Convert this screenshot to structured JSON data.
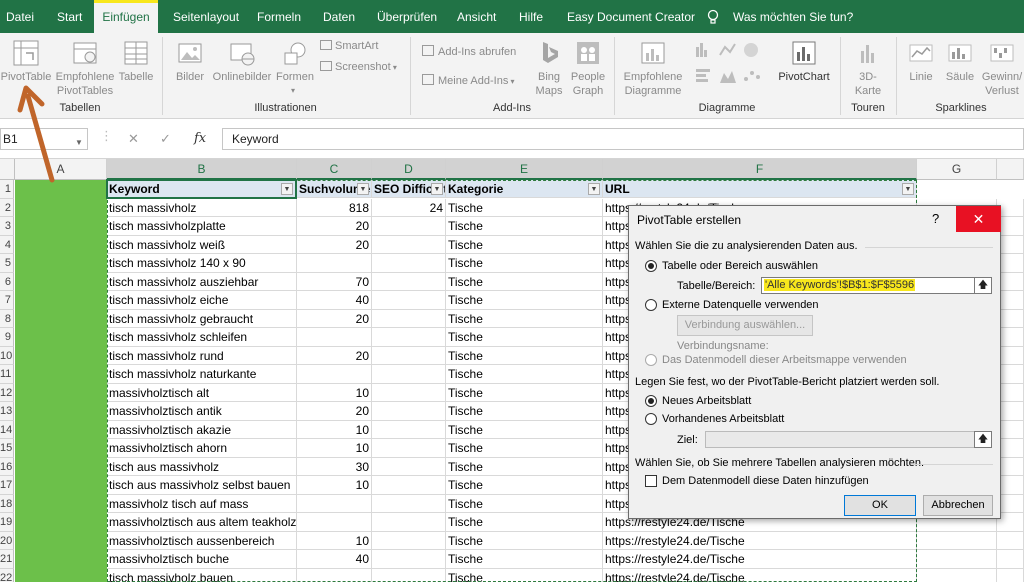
{
  "menu": {
    "items": [
      "Datei",
      "Start",
      "Einfügen",
      "Seitenlayout",
      "Formeln",
      "Daten",
      "Überprüfen",
      "Ansicht",
      "Hilfe",
      "Easy Document Creator"
    ],
    "tell_me": "Was möchten Sie tun?",
    "active": "Einfügen"
  },
  "ribbon": {
    "pivot_table": "PivotTable",
    "rec_pivot_1": "Empfohlene",
    "rec_pivot_2": "PivotTables",
    "table": "Tabelle",
    "group_tables": "Tabellen",
    "pictures": "Bilder",
    "online_pictures": "Onlinebilder",
    "shapes": "Formen",
    "smartart": "SmartArt",
    "screenshot": "Screenshot",
    "group_illustrations": "Illustrationen",
    "get_addins": "Add-Ins abrufen",
    "my_addins": "Meine Add-Ins",
    "bing_maps_1": "Bing",
    "bing_maps_2": "Maps",
    "people_graph_1": "People",
    "people_graph_2": "Graph",
    "group_addins": "Add-Ins",
    "rec_charts_1": "Empfohlene",
    "rec_charts_2": "Diagramme",
    "pivot_chart": "PivotChart",
    "group_charts": "Diagramme",
    "map3d_1": "3D-",
    "map3d_2": "Karte",
    "group_tours": "Touren",
    "spark_line": "Linie",
    "spark_column": "Säule",
    "spark_winloss_1": "Gewinn/",
    "spark_winloss_2": "Verlust",
    "group_sparklines": "Sparklines"
  },
  "formula_bar": {
    "name_box": "B1",
    "cancel": "✕",
    "confirm": "✓",
    "fx": "fx",
    "content": "Keyword"
  },
  "sheet": {
    "columns": [
      "A",
      "B",
      "C",
      "D",
      "E",
      "F",
      "G"
    ],
    "headers": [
      "Keyword",
      "Suchvolumen",
      "SEO Difficulty",
      "Kategorie",
      "URL"
    ],
    "rows": [
      {
        "n": "1"
      },
      {
        "n": "2",
        "kw": "tisch massivholz",
        "sv": "818",
        "seo": "24",
        "kat": "Tische",
        "url": "https://restyle24.de/Tische"
      },
      {
        "n": "3",
        "kw": "tisch massivholzplatte",
        "sv": "20",
        "seo": "",
        "kat": "Tische",
        "url": "https://restyle24.de/Tische"
      },
      {
        "n": "4",
        "kw": "tisch massivholz weiß",
        "sv": "20",
        "seo": "",
        "kat": "Tische",
        "url": "https://restyle24.de/Tische"
      },
      {
        "n": "5",
        "kw": "tisch massivholz 140 x 90",
        "sv": "",
        "seo": "",
        "kat": "Tische",
        "url": "https://restyle24.de/Tische"
      },
      {
        "n": "6",
        "kw": "tisch massivholz ausziehbar",
        "sv": "70",
        "seo": "",
        "kat": "Tische",
        "url": "https://restyle24.de/Tische"
      },
      {
        "n": "7",
        "kw": "tisch massivholz eiche",
        "sv": "40",
        "seo": "",
        "kat": "Tische",
        "url": "https://restyle24.de/Tische"
      },
      {
        "n": "8",
        "kw": "tisch massivholz gebraucht",
        "sv": "20",
        "seo": "",
        "kat": "Tische",
        "url": "https://restyle24.de/Tische"
      },
      {
        "n": "9",
        "kw": "tisch massivholz schleifen",
        "sv": "",
        "seo": "",
        "kat": "Tische",
        "url": "https://restyle24.de/Tische"
      },
      {
        "n": "10",
        "kw": "tisch massivholz rund",
        "sv": "20",
        "seo": "",
        "kat": "Tische",
        "url": "https://restyle24.de/Tische"
      },
      {
        "n": "11",
        "kw": "tisch massivholz naturkante",
        "sv": "",
        "seo": "",
        "kat": "Tische",
        "url": "https://restyle24.de/Tische"
      },
      {
        "n": "12",
        "kw": "massivholztisch alt",
        "sv": "10",
        "seo": "",
        "kat": "Tische",
        "url": "https://restyle24.de/Tische"
      },
      {
        "n": "13",
        "kw": "massivholztisch antik",
        "sv": "20",
        "seo": "",
        "kat": "Tische",
        "url": "https://restyle24.de/Tische"
      },
      {
        "n": "14",
        "kw": "massivholztisch akazie",
        "sv": "10",
        "seo": "",
        "kat": "Tische",
        "url": "https://restyle24.de/Tische"
      },
      {
        "n": "15",
        "kw": "massivholztisch ahorn",
        "sv": "10",
        "seo": "",
        "kat": "Tische",
        "url": "https://restyle24.de/Tische"
      },
      {
        "n": "16",
        "kw": "tisch aus massivholz",
        "sv": "30",
        "seo": "",
        "kat": "Tische",
        "url": "https://restyle24.de/Tische"
      },
      {
        "n": "17",
        "kw": "tisch aus massivholz selbst bauen",
        "sv": "10",
        "seo": "",
        "kat": "Tische",
        "url": "https://restyle24.de/Tische"
      },
      {
        "n": "18",
        "kw": "massivholz tisch auf mass",
        "sv": "",
        "seo": "",
        "kat": "Tische",
        "url": "https://restyle24.de/Tische"
      },
      {
        "n": "19",
        "kw": "massivholztisch aus altem teakholz",
        "sv": "",
        "seo": "",
        "kat": "Tische",
        "url": "https://restyle24.de/Tische"
      },
      {
        "n": "20",
        "kw": "massivholztisch aussenbereich",
        "sv": "10",
        "seo": "",
        "kat": "Tische",
        "url": "https://restyle24.de/Tische"
      },
      {
        "n": "21",
        "kw": "massivholztisch buche",
        "sv": "40",
        "seo": "",
        "kat": "Tische",
        "url": "https://restyle24.de/Tische"
      },
      {
        "n": "22",
        "kw": "tisch massivholz bauen",
        "sv": "",
        "seo": "",
        "kat": "Tische",
        "url": "https://restyle24.de/Tische"
      }
    ]
  },
  "dialog": {
    "title": "PivotTable erstellen",
    "help": "?",
    "close": "✕",
    "section_data": "Wählen Sie die zu analysierenden Daten aus.",
    "opt_table": "Tabelle oder Bereich auswählen",
    "range_label": "Tabelle/Bereich:",
    "range_value": "'Alle Keywords'!$B$1:$F$5596",
    "opt_external": "Externe Datenquelle verwenden",
    "choose_connection": "Verbindung auswählen...",
    "connection_name": "Verbindungsname:",
    "opt_datamodel": "Das Datenmodell dieser Arbeitsmappe verwenden",
    "section_place": "Legen Sie fest, wo der PivotTable-Bericht platziert werden soll.",
    "opt_new_sheet": "Neues Arbeitsblatt",
    "opt_existing_sheet": "Vorhandenes Arbeitsblatt",
    "target_label": "Ziel:",
    "target_value": "",
    "section_multi": "Wählen Sie, ob Sie mehrere Tabellen analysieren möchten.",
    "add_datamodel": "Dem Datenmodell diese Daten hinzufügen",
    "ok": "OK",
    "cancel": "Abbrechen"
  },
  "colors": {
    "accent": "#217346",
    "highlight": "#f8e71c",
    "column_a_fill": "#6cc04a",
    "header_fill": "#dce6f1",
    "arrow": "#c0652a",
    "close_red": "#e81123"
  }
}
